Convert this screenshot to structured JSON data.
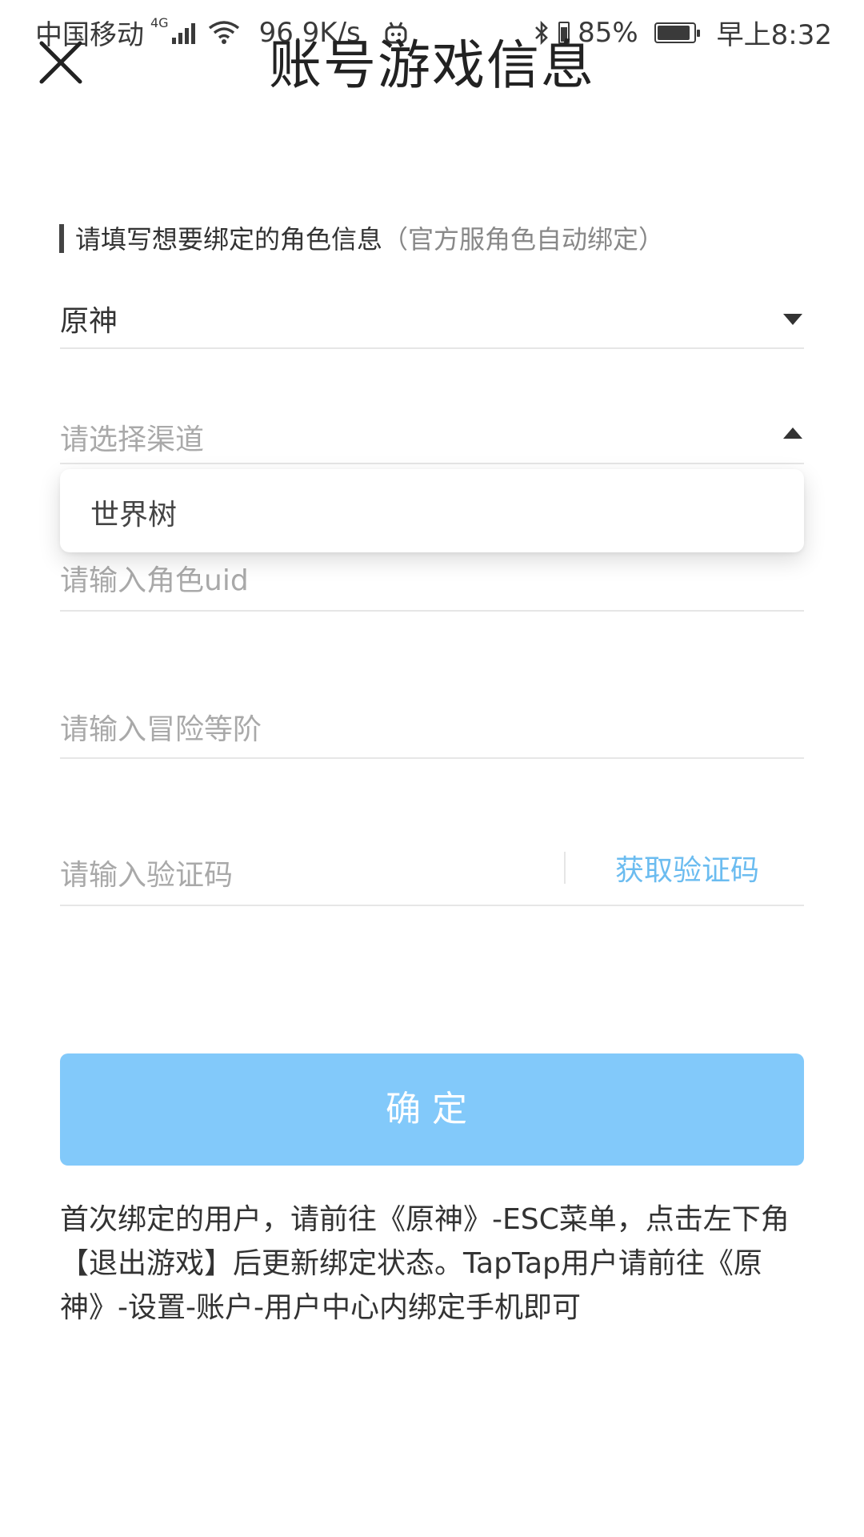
{
  "status_bar": {
    "carrier": "中国移动",
    "network": "4G",
    "speed": "96.9K/s",
    "battery": "85%",
    "time": "早上8:32"
  },
  "header": {
    "title": "账号游戏信息",
    "close_icon": "close-icon"
  },
  "section": {
    "label": "请填写想要绑定的角色信息",
    "hint": "（官方服角色自动绑定）"
  },
  "game_select": {
    "value": "原神"
  },
  "channel_select": {
    "placeholder": "请选择渠道",
    "options": [
      "世界树"
    ]
  },
  "uid_input": {
    "placeholder": "请输入角色uid"
  },
  "level_input": {
    "placeholder": "请输入冒险等阶"
  },
  "code_input": {
    "placeholder": "请输入验证码",
    "get_code_label": "获取验证码"
  },
  "confirm_button": {
    "label": "确定"
  },
  "notice": "首次绑定的用户，请前往《原神》-ESC菜单，点击左下角【退出游戏】后更新绑定状态。TapTap用户请前往《原神》-设置-账户-用户中心内绑定手机即可",
  "colors": {
    "accent": "#82c9fa",
    "link": "#6bbcf0",
    "placeholder": "#a9a9a9"
  }
}
